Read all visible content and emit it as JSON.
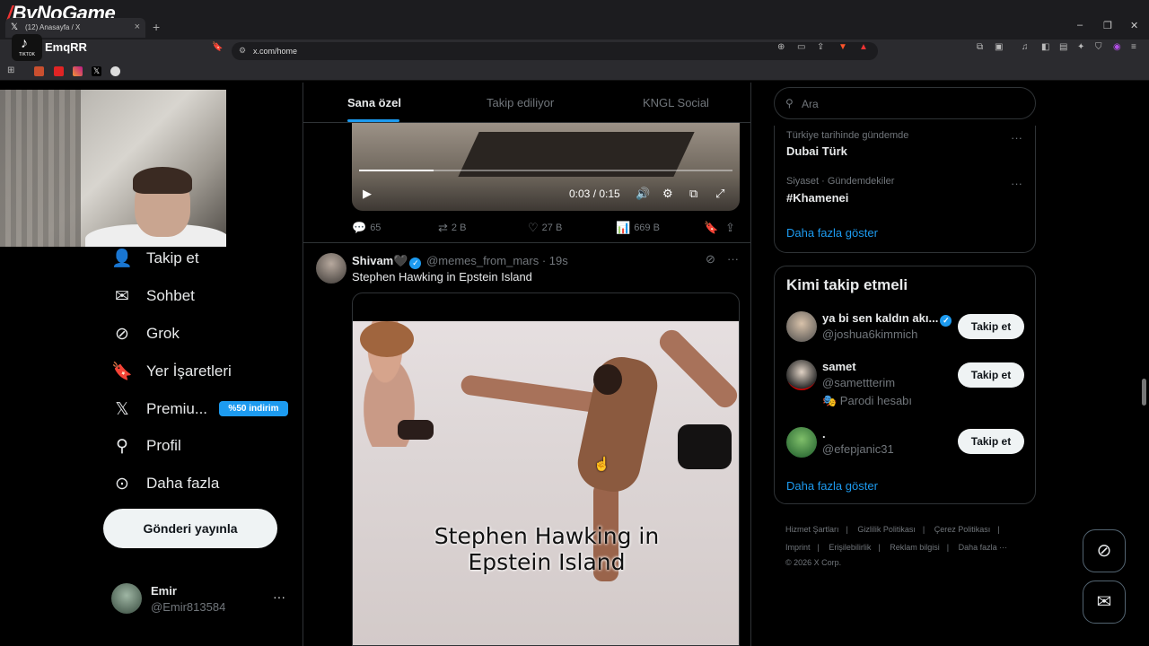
{
  "browser": {
    "brand_logo": "ByNoGame",
    "tab_title": "(12) Anasayfa / X",
    "tab_close": "×",
    "new_tab": "+",
    "url": "x.com/home",
    "window_controls": [
      "–",
      "❐",
      "✕"
    ]
  },
  "stream_overlay": {
    "tiktok_label": "TIKTOK",
    "tiktok_name": "EmqRR"
  },
  "nav": {
    "items": [
      {
        "label": "Takip et",
        "icon": "add-user-icon"
      },
      {
        "label": "Sohbet",
        "icon": "mail-icon"
      },
      {
        "label": "Grok",
        "icon": "grok-icon"
      },
      {
        "label": "Yer İşaretleri",
        "icon": "bookmark-icon"
      },
      {
        "label": "Premiu...",
        "icon": "x-logo-icon"
      },
      {
        "label": "Profil",
        "icon": "person-icon"
      },
      {
        "label": "Daha fazla",
        "icon": "more-circle-icon"
      }
    ],
    "premium_badge": "%50 indirim",
    "post_button": "Gönderi yayınla"
  },
  "account": {
    "name": "Emir",
    "handle": "@Emir813584",
    "more": "···"
  },
  "feed": {
    "tabs": [
      "Sana özel",
      "Takip ediliyor",
      "KNGL Social"
    ],
    "active_tab": 0,
    "video1": {
      "time": "0:03 / 0:15",
      "progress": 0.2
    },
    "actions": {
      "replies": "65",
      "reposts": "2 B",
      "likes": "27 B",
      "views": "669 B"
    },
    "tweet": {
      "name": "Shivam🖤",
      "handle": "@memes_from_mars",
      "time": "· 19s",
      "text": "Stephen Hawking in Epstein Island",
      "video_caption_line1": "Stephen Hawking in",
      "video_caption_line2": "Epstein Island"
    }
  },
  "sidebar": {
    "search_placeholder": "Ara",
    "trends": [
      {
        "meta": "Türkiye tarihinde gündemde",
        "name": "Dubai Türk"
      },
      {
        "meta": "Siyaset · Gündemdekiler",
        "name": "#Khamenei"
      }
    ],
    "trends_more": "Daha fazla göster",
    "who_to_follow": {
      "title": "Kimi takip etmeli",
      "users": [
        {
          "name": "ya bi sen kaldın akı...",
          "handle": "@joshua6kimmich",
          "button": "Takip et",
          "verified": true
        },
        {
          "name": "samet",
          "handle": "@samettterim",
          "button": "Takip et",
          "note": "🎭 Parodi hesabı"
        },
        {
          "name": ".",
          "handle": "@efepjanic31",
          "button": "Takip et"
        }
      ],
      "more": "Daha fazla göster"
    },
    "footer": {
      "links": [
        "Hizmet Şartları",
        "|",
        "Gizlilik Politikası",
        "|",
        "Çerez Politikası",
        "|",
        "Imprint",
        "|",
        "Erişilebilirlik",
        "|",
        "Reklam bilgisi",
        "|",
        "Daha fazla ···"
      ],
      "copyright": "© 2026 X Corp."
    }
  },
  "colors": {
    "accent": "#1d9bf0",
    "background": "#000000",
    "border": "#2f3336",
    "muted_text": "#71767b"
  }
}
